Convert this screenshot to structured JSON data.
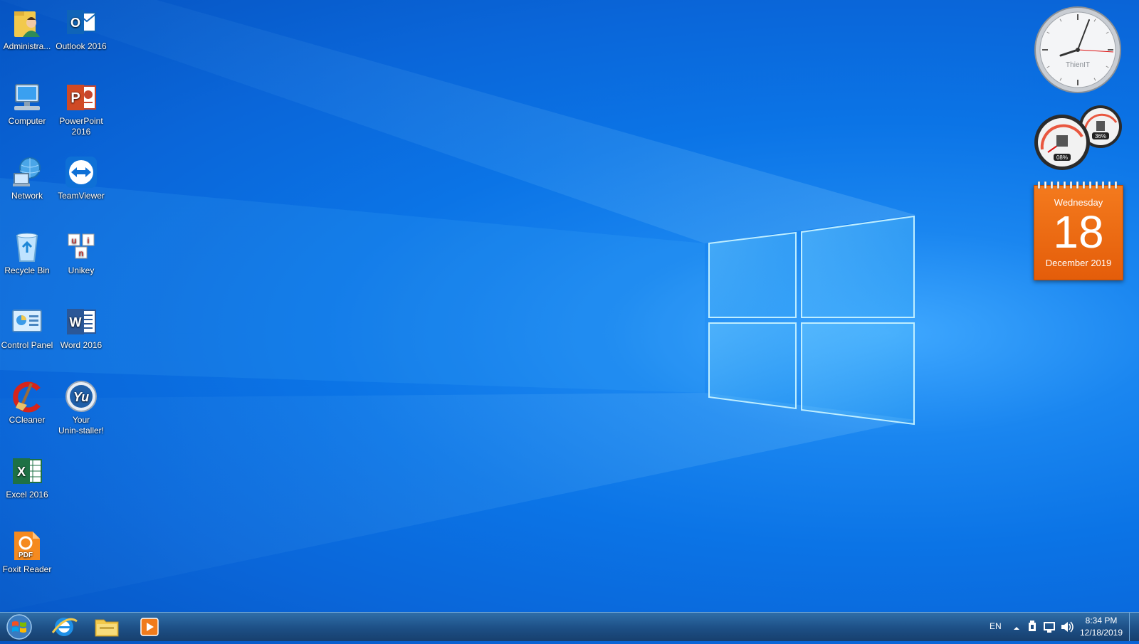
{
  "desktop": {
    "icons": [
      {
        "label": "Administra...",
        "icon": "user-folder-icon"
      },
      {
        "label": "Outlook 2016",
        "icon": "outlook-icon"
      },
      {
        "label": "Computer",
        "icon": "computer-icon"
      },
      {
        "label": "PowerPoint\n2016",
        "icon": "powerpoint-icon"
      },
      {
        "label": "Network",
        "icon": "network-icon"
      },
      {
        "label": "TeamViewer",
        "icon": "teamviewer-icon"
      },
      {
        "label": "Recycle Bin",
        "icon": "recycle-bin-icon"
      },
      {
        "label": "Unikey",
        "icon": "unikey-icon"
      },
      {
        "label": "Control Panel",
        "icon": "control-panel-icon"
      },
      {
        "label": "Word 2016",
        "icon": "word-icon"
      },
      {
        "label": "CCleaner",
        "icon": "ccleaner-icon"
      },
      {
        "label": "Your\nUnin-staller!",
        "icon": "uninstaller-icon"
      },
      {
        "label": "Excel 2016",
        "icon": "excel-icon"
      },
      {
        "label": "Foxit Reader",
        "icon": "foxit-reader-icon"
      }
    ]
  },
  "gadgets": {
    "clock": {
      "brand": "ThienIT"
    },
    "meter": {
      "cpu": "08%",
      "memory": "36%"
    },
    "calendar": {
      "weekday": "Wednesday",
      "day": "18",
      "month_year": "December 2019"
    }
  },
  "taskbar": {
    "pinned": [
      "internet-explorer-icon",
      "file-explorer-icon",
      "media-player-icon"
    ],
    "language": "EN",
    "time": "8:34 PM",
    "date": "12/18/2019"
  },
  "colors": {
    "taskbar": "#1d4f85",
    "calendar": "#e45d0a",
    "wallpaper": "#0b74e6"
  }
}
